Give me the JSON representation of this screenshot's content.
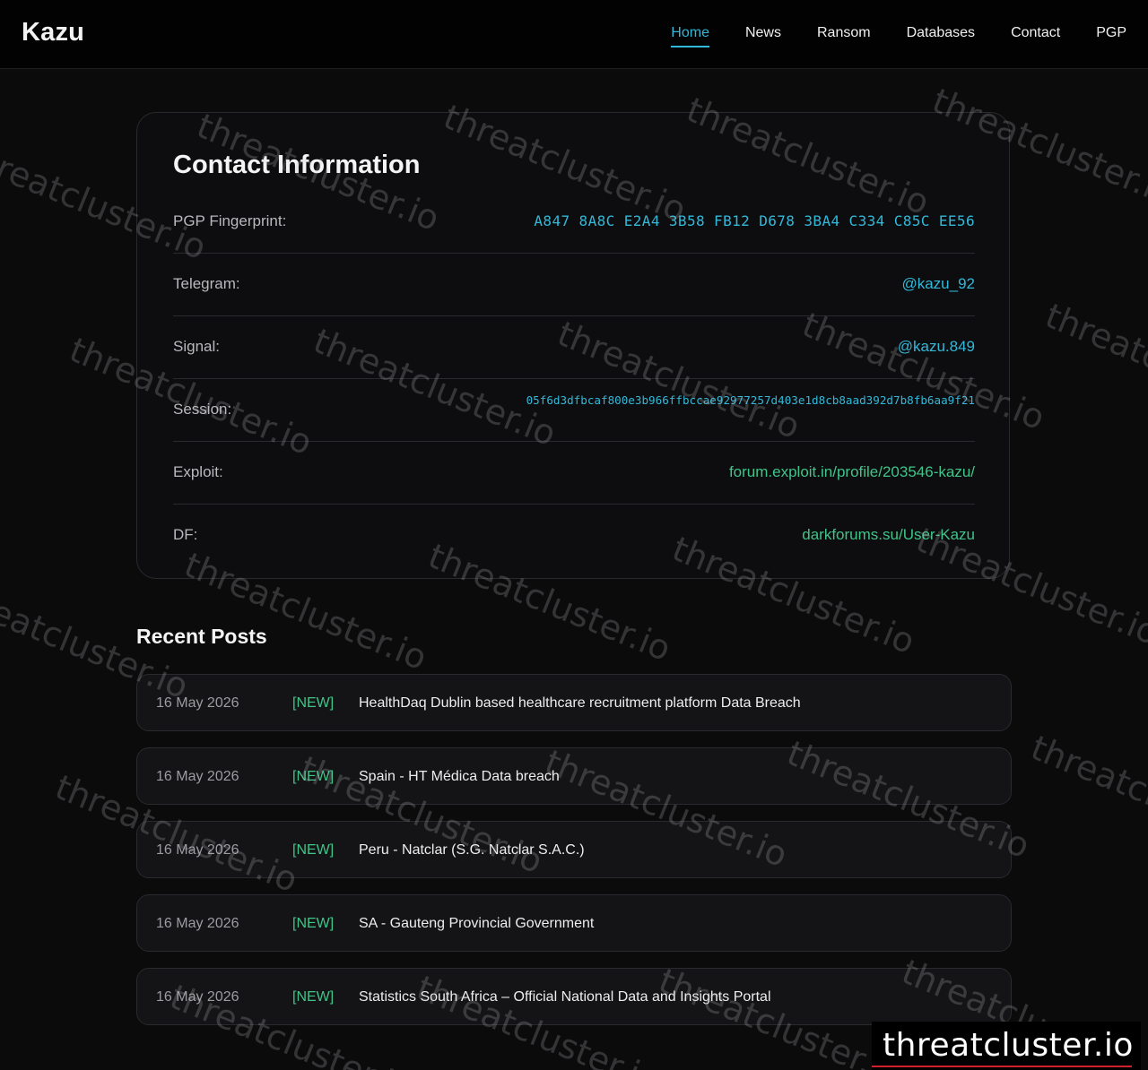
{
  "header": {
    "brand": "Kazu",
    "nav": [
      {
        "label": "Home",
        "active": true
      },
      {
        "label": "News"
      },
      {
        "label": "Ransom"
      },
      {
        "label": "Databases"
      },
      {
        "label": "Contact"
      },
      {
        "label": "PGP"
      }
    ]
  },
  "contact": {
    "title": "Contact Information",
    "rows": [
      {
        "label": "PGP Fingerprint:",
        "value": "A847 8A8C E2A4 3B58 FB12 D678 3BA4 C334 C85C EE56"
      },
      {
        "label": "Telegram:",
        "value": "@kazu_92"
      },
      {
        "label": "Signal:",
        "value": "@kazu.849"
      },
      {
        "label": "Session:",
        "value": "05f6d3dfbcaf800e3b966ffbccae92977257d403e1d8cb8aad392d7b8fb6aa9f21"
      },
      {
        "label": "Exploit:",
        "value": "forum.exploit.in/profile/203546-kazu/"
      },
      {
        "label": "DF:",
        "value": "darkforums.su/User-Kazu"
      }
    ]
  },
  "recent_posts": {
    "title": "Recent Posts",
    "items": [
      {
        "date": "16 May 2026",
        "tag": "[NEW]",
        "title": "HealthDaq Dublin based healthcare recruitment platform Data Breach"
      },
      {
        "date": "16 May 2026",
        "tag": "[NEW]",
        "title": "Spain - HT Médica Data breach"
      },
      {
        "date": "16 May 2026",
        "tag": "[NEW]",
        "title": "Peru - Natclar (S.G. Natclar S.A.C.)"
      },
      {
        "date": "16 May 2026",
        "tag": "[NEW]",
        "title": "SA - Gauteng Provincial Government"
      },
      {
        "date": "16 May 2026",
        "tag": "[NEW]",
        "title": "Statistics South Africa – Official National Data and Insights Portal"
      }
    ]
  },
  "watermark": {
    "text": "threatcluster.io",
    "badge": "threatcluster.io"
  },
  "colors": {
    "accent": "#32b8d8",
    "link_green": "#3fc48a",
    "background": "#0b0b0c"
  }
}
